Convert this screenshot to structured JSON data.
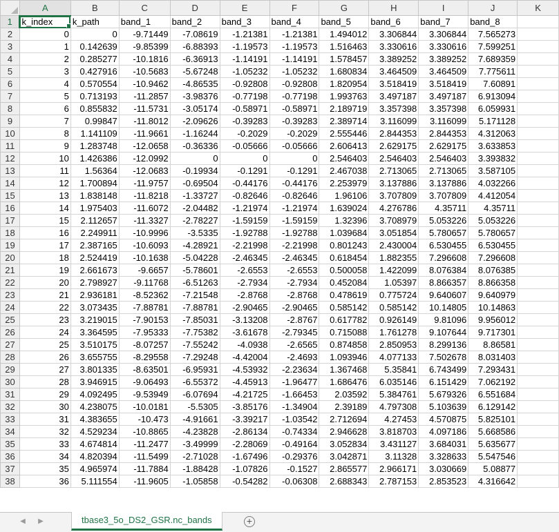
{
  "columns": [
    "A",
    "B",
    "C",
    "D",
    "E",
    "F",
    "G",
    "H",
    "I",
    "J",
    "K"
  ],
  "active_column": "A",
  "active_row": 1,
  "headers": [
    "k_index",
    "k_path",
    "band_1",
    "band_2",
    "band_3",
    "band_4",
    "band_5",
    "band_6",
    "band_7",
    "band_8"
  ],
  "rows": [
    [
      "0",
      "0",
      "-9.71449",
      "-7.08619",
      "-1.21381",
      "-1.21381",
      "1.494012",
      "3.306844",
      "3.306844",
      "7.565273"
    ],
    [
      "1",
      "0.142639",
      "-9.85399",
      "-6.88393",
      "-1.19573",
      "-1.19573",
      "1.516463",
      "3.330616",
      "3.330616",
      "7.599251"
    ],
    [
      "2",
      "0.285277",
      "-10.1816",
      "-6.36913",
      "-1.14191",
      "-1.14191",
      "1.578457",
      "3.389252",
      "3.389252",
      "7.689359"
    ],
    [
      "3",
      "0.427916",
      "-10.5683",
      "-5.67248",
      "-1.05232",
      "-1.05232",
      "1.680834",
      "3.464509",
      "3.464509",
      "7.775611"
    ],
    [
      "4",
      "0.570554",
      "-10.9462",
      "-4.86535",
      "-0.92808",
      "-0.92808",
      "1.820954",
      "3.518419",
      "3.518419",
      "7.60891"
    ],
    [
      "5",
      "0.713193",
      "-11.2857",
      "-3.98376",
      "-0.77198",
      "-0.77198",
      "1.993763",
      "3.497187",
      "3.497187",
      "6.913094"
    ],
    [
      "6",
      "0.855832",
      "-11.5731",
      "-3.05174",
      "-0.58971",
      "-0.58971",
      "2.189719",
      "3.357398",
      "3.357398",
      "6.059931"
    ],
    [
      "7",
      "0.99847",
      "-11.8012",
      "-2.09626",
      "-0.39283",
      "-0.39283",
      "2.389714",
      "3.116099",
      "3.116099",
      "5.171128"
    ],
    [
      "8",
      "1.141109",
      "-11.9661",
      "-1.16244",
      "-0.2029",
      "-0.2029",
      "2.555446",
      "2.844353",
      "2.844353",
      "4.312063"
    ],
    [
      "9",
      "1.283748",
      "-12.0658",
      "-0.36336",
      "-0.05666",
      "-0.05666",
      "2.606413",
      "2.629175",
      "2.629175",
      "3.633853"
    ],
    [
      "10",
      "1.426386",
      "-12.0992",
      "0",
      "0",
      "0",
      "2.546403",
      "2.546403",
      "2.546403",
      "3.393832"
    ],
    [
      "11",
      "1.56364",
      "-12.0683",
      "-0.19934",
      "-0.1291",
      "-0.1291",
      "2.467038",
      "2.713065",
      "2.713065",
      "3.587105"
    ],
    [
      "12",
      "1.700894",
      "-11.9757",
      "-0.69504",
      "-0.44176",
      "-0.44176",
      "2.253979",
      "3.137886",
      "3.137886",
      "4.032266"
    ],
    [
      "13",
      "1.838148",
      "-11.8218",
      "-1.33727",
      "-0.82646",
      "-0.82646",
      "1.96106",
      "3.707809",
      "3.707809",
      "4.412054"
    ],
    [
      "14",
      "1.975403",
      "-11.6072",
      "-2.04482",
      "-1.21974",
      "-1.21974",
      "1.639024",
      "4.276786",
      "4.35711",
      "4.35711"
    ],
    [
      "15",
      "2.112657",
      "-11.3327",
      "-2.78227",
      "-1.59159",
      "-1.59159",
      "1.32396",
      "3.708979",
      "5.053226",
      "5.053226"
    ],
    [
      "16",
      "2.249911",
      "-10.9996",
      "-3.5335",
      "-1.92788",
      "-1.92788",
      "1.039684",
      "3.051854",
      "5.780657",
      "5.780657"
    ],
    [
      "17",
      "2.387165",
      "-10.6093",
      "-4.28921",
      "-2.21998",
      "-2.21998",
      "0.801243",
      "2.430004",
      "6.530455",
      "6.530455"
    ],
    [
      "18",
      "2.524419",
      "-10.1638",
      "-5.04228",
      "-2.46345",
      "-2.46345",
      "0.618454",
      "1.882355",
      "7.296608",
      "7.296608"
    ],
    [
      "19",
      "2.661673",
      "-9.6657",
      "-5.78601",
      "-2.6553",
      "-2.6553",
      "0.500058",
      "1.422099",
      "8.076384",
      "8.076385"
    ],
    [
      "20",
      "2.798927",
      "-9.11768",
      "-6.51263",
      "-2.7934",
      "-2.7934",
      "0.452084",
      "1.05397",
      "8.866357",
      "8.866358"
    ],
    [
      "21",
      "2.936181",
      "-8.52362",
      "-7.21548",
      "-2.8768",
      "-2.8768",
      "0.478619",
      "0.775724",
      "9.640607",
      "9.640979"
    ],
    [
      "22",
      "3.073435",
      "-7.88781",
      "-7.88781",
      "-2.90465",
      "-2.90465",
      "0.585142",
      "0.585142",
      "10.14805",
      "10.14863"
    ],
    [
      "23",
      "3.219015",
      "-7.90153",
      "-7.85031",
      "-3.13208",
      "-2.8767",
      "0.617782",
      "0.926149",
      "9.81096",
      "9.956012"
    ],
    [
      "24",
      "3.364595",
      "-7.95333",
      "-7.75382",
      "-3.61678",
      "-2.79345",
      "0.715088",
      "1.761278",
      "9.107644",
      "9.717301"
    ],
    [
      "25",
      "3.510175",
      "-8.07257",
      "-7.55242",
      "-4.0938",
      "-2.6565",
      "0.874858",
      "2.850953",
      "8.299136",
      "8.86581"
    ],
    [
      "26",
      "3.655755",
      "-8.29558",
      "-7.29248",
      "-4.42004",
      "-2.4693",
      "1.093946",
      "4.077133",
      "7.502678",
      "8.031403"
    ],
    [
      "27",
      "3.801335",
      "-8.63501",
      "-6.95931",
      "-4.53932",
      "-2.23634",
      "1.367468",
      "5.35841",
      "6.743499",
      "7.293431"
    ],
    [
      "28",
      "3.946915",
      "-9.06493",
      "-6.55372",
      "-4.45913",
      "-1.96477",
      "1.686476",
      "6.035146",
      "6.151429",
      "7.062192"
    ],
    [
      "29",
      "4.092495",
      "-9.53949",
      "-6.07694",
      "-4.21725",
      "-1.66453",
      "2.03592",
      "5.384761",
      "5.679326",
      "6.551684"
    ],
    [
      "30",
      "4.238075",
      "-10.0181",
      "-5.5305",
      "-3.85176",
      "-1.34904",
      "2.39189",
      "4.797308",
      "5.103639",
      "6.129142"
    ],
    [
      "31",
      "4.383655",
      "-10.473",
      "-4.91661",
      "-3.39217",
      "-1.03542",
      "2.712694",
      "4.27453",
      "4.570875",
      "5.825101"
    ],
    [
      "32",
      "4.529234",
      "-10.8865",
      "-4.23828",
      "-2.86134",
      "-0.74334",
      "2.946628",
      "3.818703",
      "4.097186",
      "5.668586"
    ],
    [
      "33",
      "4.674814",
      "-11.2477",
      "-3.49999",
      "-2.28069",
      "-0.49164",
      "3.052834",
      "3.431127",
      "3.684031",
      "5.635677"
    ],
    [
      "34",
      "4.820394",
      "-11.5499",
      "-2.71028",
      "-1.67496",
      "-0.29376",
      "3.042871",
      "3.11328",
      "3.328633",
      "5.547546"
    ],
    [
      "35",
      "4.965974",
      "-11.7884",
      "-1.88428",
      "-1.07826",
      "-0.1527",
      "2.865577",
      "2.966171",
      "3.030669",
      "5.08877"
    ],
    [
      "36",
      "5.111554",
      "-11.9605",
      "-1.05858",
      "-0.54282",
      "-0.06308",
      "2.688343",
      "2.787153",
      "2.853523",
      "4.316642"
    ]
  ],
  "sheet_tab": "tbase3_5o_DS2_GSR.nc_bands",
  "accent_color": "#217346"
}
